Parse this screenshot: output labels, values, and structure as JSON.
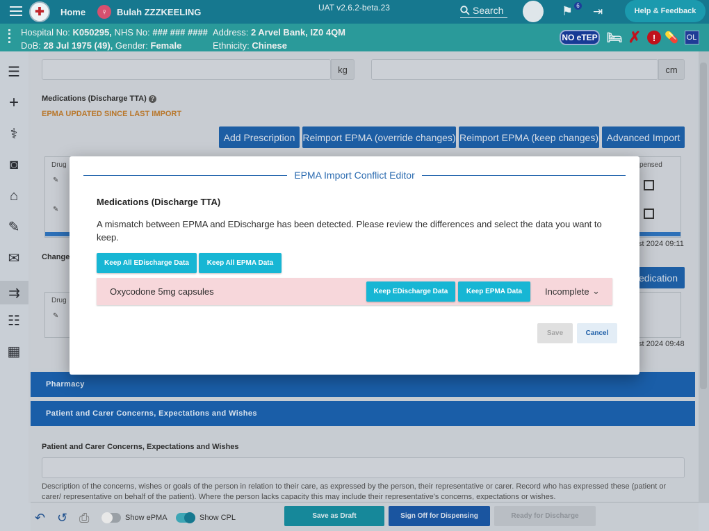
{
  "topbar": {
    "home_label": "Home",
    "patient_name": "Bulah ZZZKEELING",
    "version": "UAT v2.6.2-beta.23",
    "search_label": "Search",
    "flag_count": "6",
    "help_label": "Help & Feedback"
  },
  "banner": {
    "hospital_no_label": "Hospital No:",
    "hospital_no": "K050295,",
    "nhs_no_label": "NHS No:",
    "nhs_no": "### ### ####",
    "dob_label": "DoB:",
    "dob": "28 Jul 1975 (49),",
    "gender_label": "Gender:",
    "gender": "Female",
    "address_label": "Address:",
    "address": "2 Arvel Bank, IZ0 4QM",
    "ethnicity_label": "Ethnicity:",
    "ethnicity": "Chinese",
    "noetep": "NO eTEP",
    "ol": "OL"
  },
  "background": {
    "weight_unit": "kg",
    "height_unit": "cm",
    "med_title": "Medications (Discharge TTA)",
    "epma_updated": "EPMA UPDATED SINCE LAST IMPORT",
    "buttons": {
      "add_prescription": "Add Prescription",
      "reimport_override": "Reimport EPMA (override changes)",
      "reimport_keep": "Reimport EPMA (keep changes)",
      "advanced_import": "Advanced Import"
    },
    "table_drug_header": "Drug",
    "table_dispensed_header": "spensed",
    "changes_label": "Changes",
    "date1": "st 2024 09:11",
    "date2": "st 2024 09:48",
    "add_medication_fragment": "edication",
    "pharmacy": "Pharmacy",
    "pcc_section": "Patient and Carer Concerns, Expectations and Wishes",
    "pcc_title": "Patient and Carer Concerns, Expectations and Wishes",
    "pcc_desc": "Description of the concerns, wishes or goals of the person in relation to their care, as expressed by the person, their representative or carer. Record who has expressed these (patient or carer/ representative on behalf of the patient). Where the person lacks capacity this may include their representative's concerns, expectations or wishes."
  },
  "bottombar": {
    "show_epma": "Show ePMA",
    "show_cpl": "Show CPL",
    "save_draft": "Save as Draft",
    "sign_off": "Sign Off for Dispensing",
    "ready_discharge": "Ready for Discharge"
  },
  "modal": {
    "title": "EPMA Import Conflict Editor",
    "subtitle": "Medications (Discharge TTA)",
    "description": "A mismatch between EPMA and EDischarge has been detected. Please review the differences and select the data you want to keep.",
    "keep_all_edischarge": "Keep All EDischarge Data",
    "keep_all_epma": "Keep All EPMA Data",
    "conflicts": [
      {
        "drug": "Oxycodone 5mg capsules",
        "keep_edischarge": "Keep EDischarge Data",
        "keep_epma": "Keep EPMA Data",
        "status": "Incomplete"
      }
    ],
    "save": "Save",
    "cancel": "Cancel"
  },
  "colors": {
    "topbar": "#16788f",
    "banner": "#2a9a9a",
    "primary_blue": "#1d5ea4",
    "cyan_button": "#17b6d4",
    "conflict_row": "#f7d7db"
  }
}
